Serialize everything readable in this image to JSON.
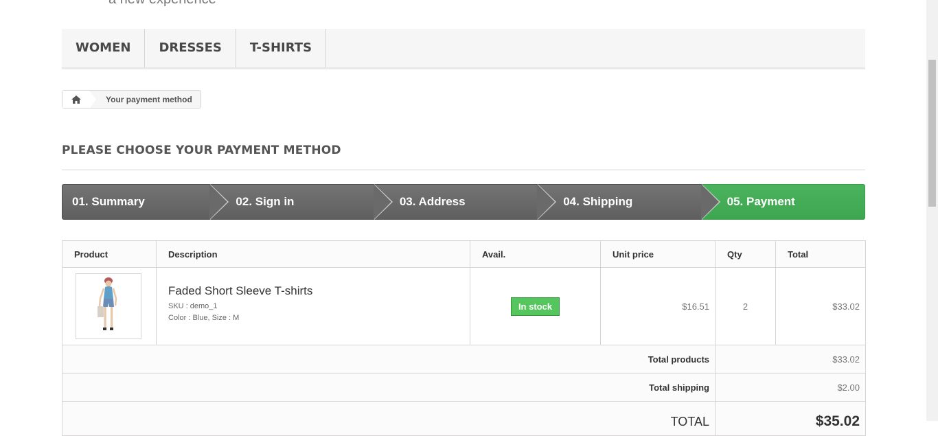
{
  "header": {
    "tagline": "a new experience"
  },
  "menu": {
    "items": [
      "WOMEN",
      "DRESSES",
      "T-SHIRTS"
    ]
  },
  "breadcrumb": {
    "home_icon": "home-icon",
    "current": "Your payment method"
  },
  "page": {
    "heading": "PLEASE CHOOSE YOUR PAYMENT METHOD"
  },
  "steps": [
    {
      "label": "01. Summary"
    },
    {
      "label": "02. Sign in"
    },
    {
      "label": "03. Address"
    },
    {
      "label": "04. Shipping"
    },
    {
      "label": "05. Payment",
      "current": true
    }
  ],
  "cart": {
    "headers": [
      "Product",
      "Description",
      "Avail.",
      "Unit price",
      "Qty",
      "Total"
    ],
    "rows": [
      {
        "name": "Faded Short Sleeve T-shirts",
        "sku": "SKU : demo_1",
        "attributes": "Color : Blue, Size : M",
        "availability": "In stock",
        "unit_price": "$16.51",
        "qty": "2",
        "total": "$33.02"
      }
    ],
    "summary": {
      "total_products_label": "Total products",
      "total_products": "$33.02",
      "total_shipping_label": "Total shipping",
      "total_shipping": "$2.00",
      "total_label": "TOTAL",
      "total": "$35.02"
    }
  },
  "colors": {
    "step_active": "#46b057",
    "step_default": "#6a6a6a",
    "in_stock": "#55c65e"
  }
}
